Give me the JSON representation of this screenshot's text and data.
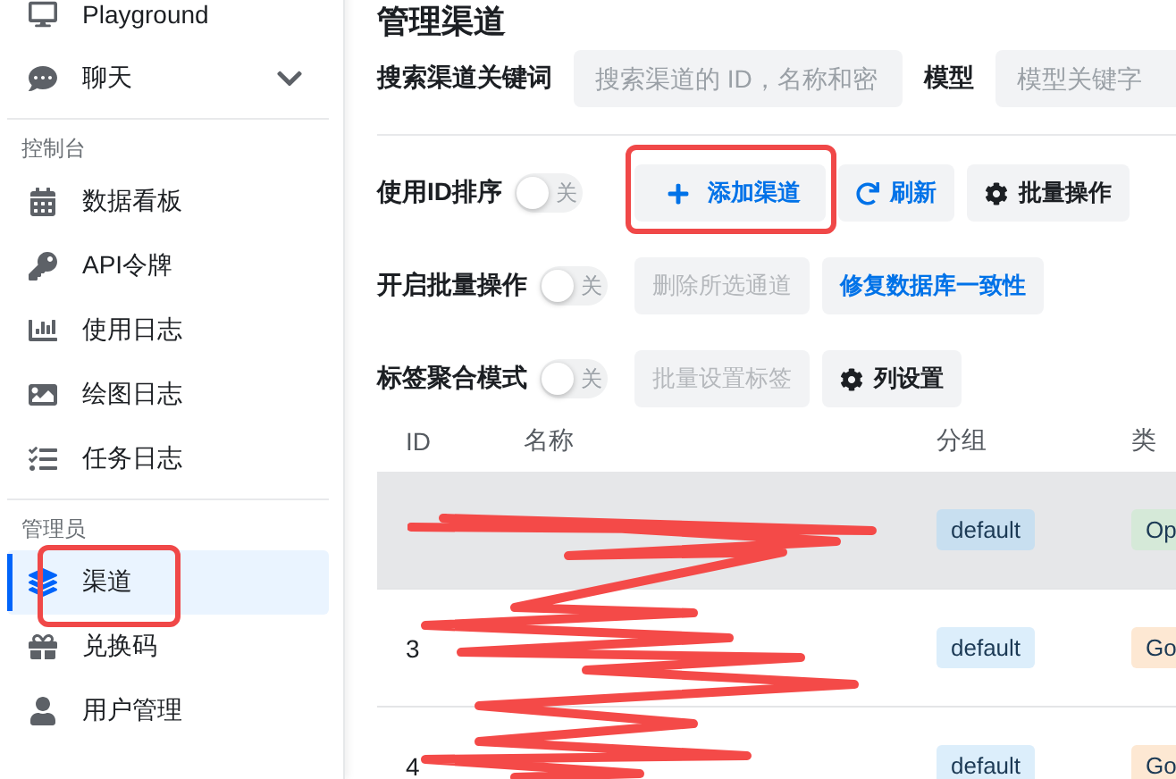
{
  "sidebar": {
    "sections": [
      {
        "items": [
          {
            "label": "Playground",
            "selected": false
          },
          {
            "label": "聊天",
            "selected": false,
            "expanded": false
          }
        ]
      },
      {
        "label": "控制台",
        "items": [
          {
            "label": "数据看板",
            "selected": false
          },
          {
            "label": "API令牌",
            "selected": false
          },
          {
            "label": "使用日志",
            "selected": false
          },
          {
            "label": "绘图日志",
            "selected": false
          },
          {
            "label": "任务日志",
            "selected": false
          }
        ]
      },
      {
        "label": "管理员",
        "items": [
          {
            "label": "渠道",
            "selected": true
          },
          {
            "label": "兑换码",
            "selected": false
          },
          {
            "label": "用户管理",
            "selected": false
          }
        ]
      }
    ]
  },
  "page_title": "管理渠道",
  "search": {
    "label": "搜索渠道关键词",
    "placeholder": "搜索渠道的 ID，名称和密",
    "model_label": "模型",
    "model_placeholder": "模型关键字"
  },
  "toolbar_rows": [
    {
      "switch": {
        "label": "使用ID排序",
        "on": false,
        "state_text": "关"
      },
      "buttons": [
        {
          "label": "添加渠道",
          "kind": "add",
          "disabled": false
        },
        {
          "label": "刷新",
          "kind": "refresh",
          "disabled": false
        },
        {
          "label": "批量操作",
          "kind": "settings",
          "disabled": false
        }
      ]
    },
    {
      "switch": {
        "label": "开启批量操作",
        "on": false,
        "state_text": "关"
      },
      "buttons": [
        {
          "label": "删除所选通道",
          "kind": "text",
          "disabled": true
        },
        {
          "label": "修复数据库一致性",
          "kind": "link",
          "disabled": false
        }
      ]
    },
    {
      "switch": {
        "label": "标签聚合模式",
        "on": false,
        "state_text": "关"
      },
      "buttons": [
        {
          "label": "批量设置标签",
          "kind": "text",
          "disabled": true
        },
        {
          "label": "列设置",
          "kind": "settings",
          "disabled": false
        }
      ]
    }
  ],
  "table": {
    "columns": [
      "ID",
      "名称",
      "分组",
      "类"
    ],
    "rows": [
      {
        "selected": true,
        "group": "default",
        "type": "Op",
        "color": "#d5e9d8"
      },
      {
        "selected": false,
        "id": "3",
        "group": "default",
        "type": "Go",
        "color": "#fde8d3"
      },
      {
        "selected": false,
        "id": "4",
        "group": "default",
        "type": "Go",
        "color": "#fde8d3"
      }
    ]
  }
}
